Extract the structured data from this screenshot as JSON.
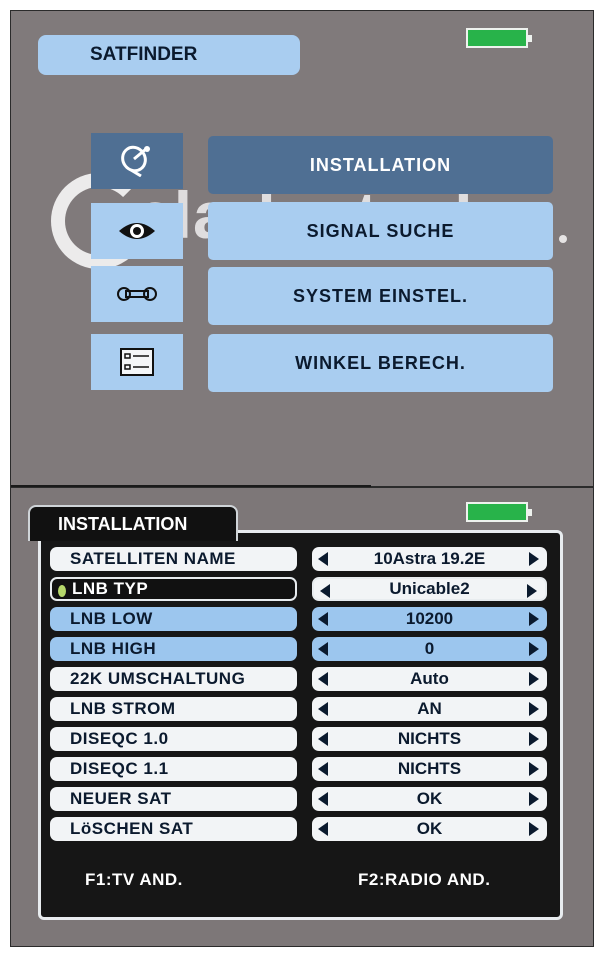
{
  "top_screen": {
    "title": "SATFINDER",
    "watermark": "clarke-tech",
    "menu": [
      {
        "label": "INSTALLATION",
        "icon": "satellite-dish-icon",
        "selected": true
      },
      {
        "label": "SIGNAL SUCHE",
        "icon": "eye-icon",
        "selected": false
      },
      {
        "label": "SYSTEM EINSTEL.",
        "icon": "wrench-icon",
        "selected": false
      },
      {
        "label": "WINKEL BERECH.",
        "icon": "list-form-icon",
        "selected": false
      }
    ]
  },
  "bottom_screen": {
    "title": "INSTALLATION",
    "rows": [
      {
        "label": "SATELLITEN NAME",
        "value": "10Astra 19.2E"
      },
      {
        "label": "LNB TYP",
        "value": "Unicable2",
        "selected": true
      },
      {
        "label": "LNB LOW",
        "value": "10200"
      },
      {
        "label": "LNB HIGH",
        "value": "0"
      },
      {
        "label": "22K UMSCHALTUNG",
        "value": "Auto"
      },
      {
        "label": "LNB STROM",
        "value": "AN"
      },
      {
        "label": "DISEQC 1.0",
        "value": "NICHTS"
      },
      {
        "label": "DISEQC 1.1",
        "value": "NICHTS"
      },
      {
        "label": "NEUER SAT",
        "value": "OK"
      },
      {
        "label": "LöSCHEN SAT",
        "value": "OK"
      }
    ],
    "footer": {
      "f1": "F1:TV AND.",
      "f2": "F2:RADIO AND."
    }
  },
  "colors": {
    "screen_bg": "#807a7b",
    "button_blue": "#a9cdf0",
    "selected_blue": "#4f6f93",
    "battery_green": "#28b34a",
    "panel_black": "#161616"
  }
}
